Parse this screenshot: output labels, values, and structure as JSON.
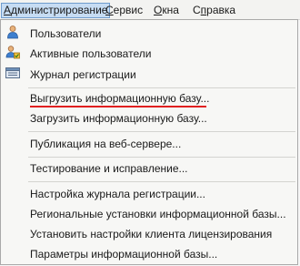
{
  "menubar": {
    "items": [
      {
        "label": "Администрирование",
        "accel": "А",
        "rest": "дминистрирование",
        "active": true
      },
      {
        "label": "Сервис",
        "accel": "С",
        "rest": "ервис",
        "active": false
      },
      {
        "label": "Окна",
        "accel": "О",
        "rest": "кна",
        "active": false
      },
      {
        "label": "Справка",
        "accel": "п",
        "pre": "С",
        "rest": "равка",
        "active": false
      }
    ]
  },
  "menu": {
    "items": [
      {
        "label": "Пользователи",
        "icon": "user-icon"
      },
      {
        "label": "Активные пользователи",
        "icon": "active-users-icon"
      },
      {
        "label": "Журнал регистрации",
        "icon": "event-log-icon"
      },
      {
        "label": "Выгрузить информационную базу..."
      },
      {
        "label": "Загрузить информационную базу..."
      },
      {
        "label": "Публикация на веб-сервере..."
      },
      {
        "label": "Тестирование и исправление..."
      },
      {
        "label": "Настройка журнала регистрации..."
      },
      {
        "label": "Региональные установки информационной базы..."
      },
      {
        "label": "Установить настройки клиента лицензирования"
      },
      {
        "label": "Параметры информационной базы..."
      }
    ]
  },
  "colors": {
    "menubar_active_bg": "#c6dcf3",
    "menubar_active_border": "#6f9ccd",
    "highlight_underline": "#e02020"
  }
}
